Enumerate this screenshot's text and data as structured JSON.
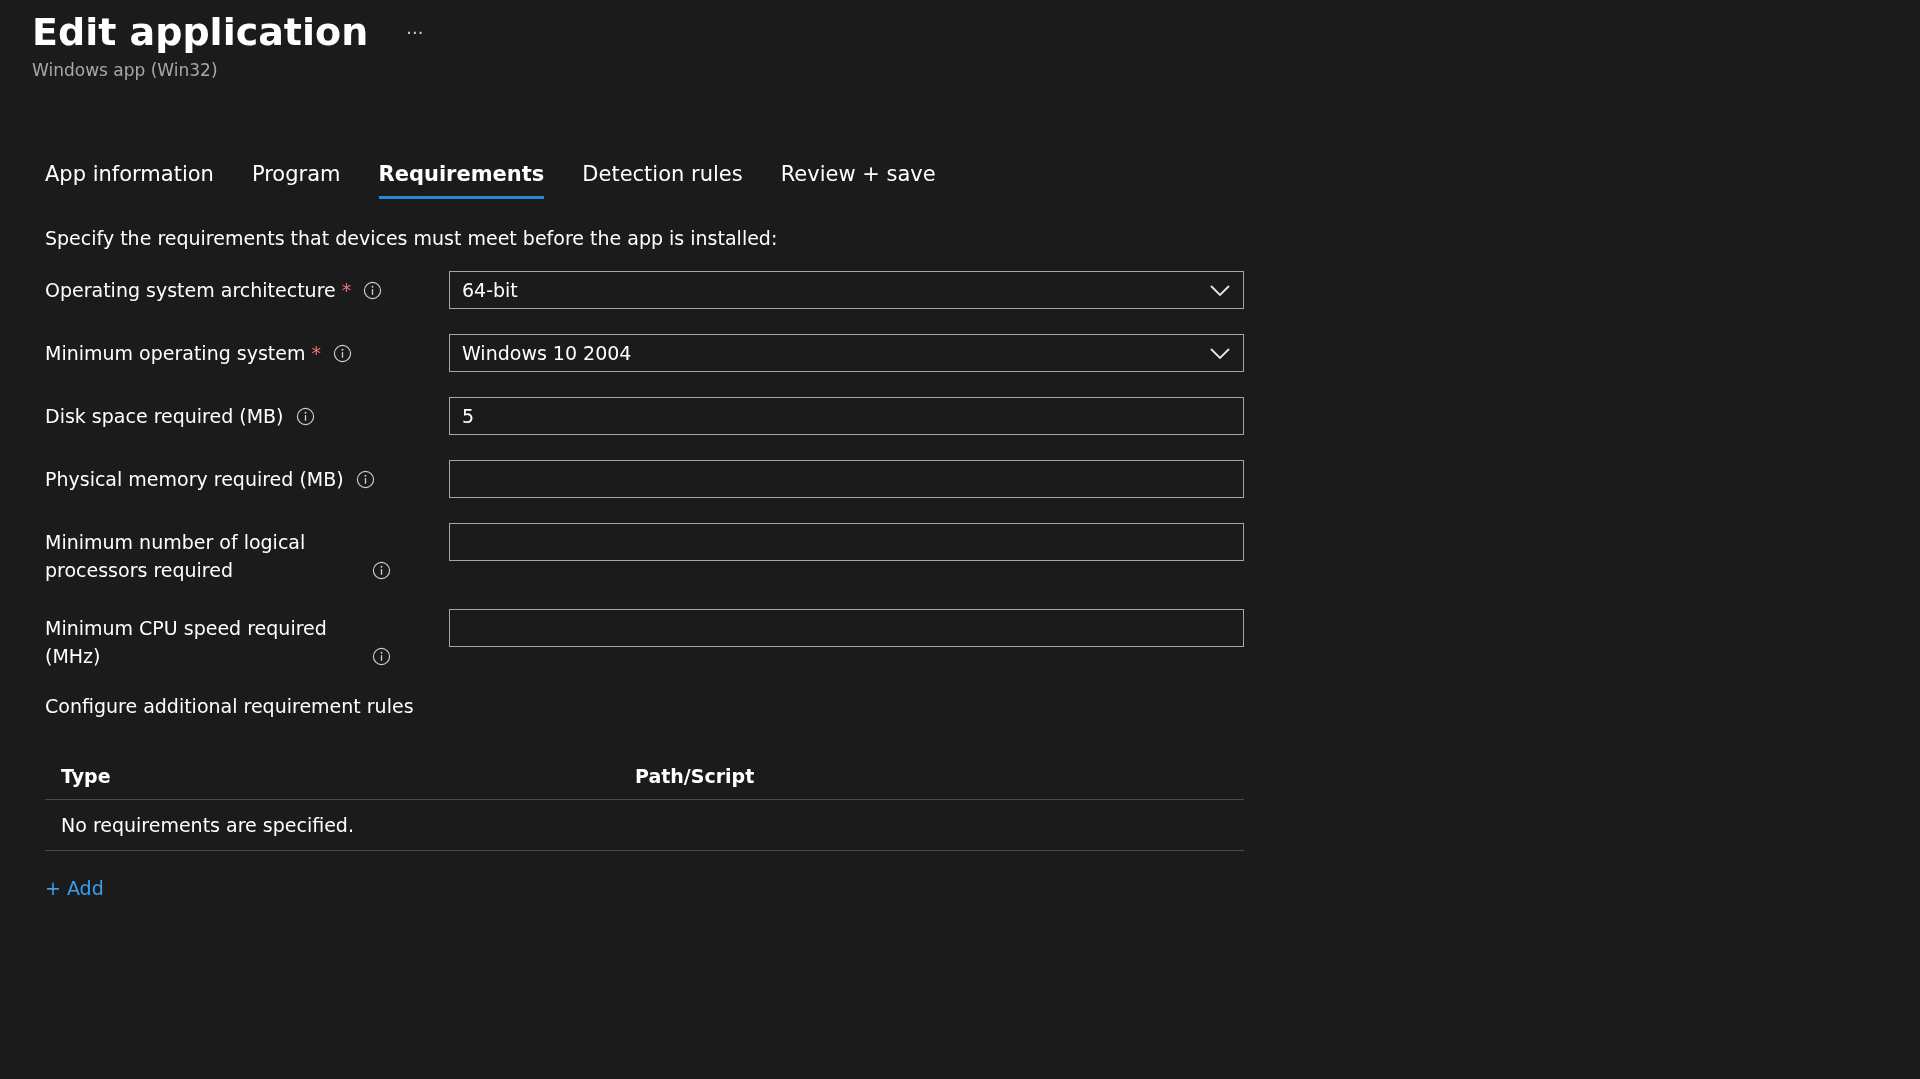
{
  "header": {
    "title": "Edit application",
    "more": "···",
    "subtitle": "Windows app (Win32)"
  },
  "tabs": [
    {
      "label": "App information",
      "selected": false
    },
    {
      "label": "Program",
      "selected": false
    },
    {
      "label": "Requirements",
      "selected": true
    },
    {
      "label": "Detection rules",
      "selected": false
    },
    {
      "label": "Review + save",
      "selected": false
    }
  ],
  "intro": "Specify the requirements that devices must meet before the app is installed:",
  "fields": [
    {
      "label": "Operating system architecture",
      "required_mark": "*",
      "kind": "dropdown",
      "value": "64-bit"
    },
    {
      "label": "Minimum operating system",
      "required_mark": "*",
      "kind": "dropdown",
      "value": "Windows 10 2004"
    },
    {
      "label": "Disk space required (MB)",
      "kind": "text",
      "value": "5"
    },
    {
      "label": "Physical memory required (MB)",
      "kind": "text"
    },
    {
      "label": "Minimum number of logical processors required",
      "kind": "text"
    },
    {
      "label": "Minimum CPU speed required (MHz)",
      "kind": "text"
    }
  ],
  "rules": {
    "heading": "Configure additional requirement rules",
    "columns": [
      "Type",
      "Path/Script"
    ],
    "empty_message": "No requirements are specified.",
    "add_link": "+ Add"
  }
}
